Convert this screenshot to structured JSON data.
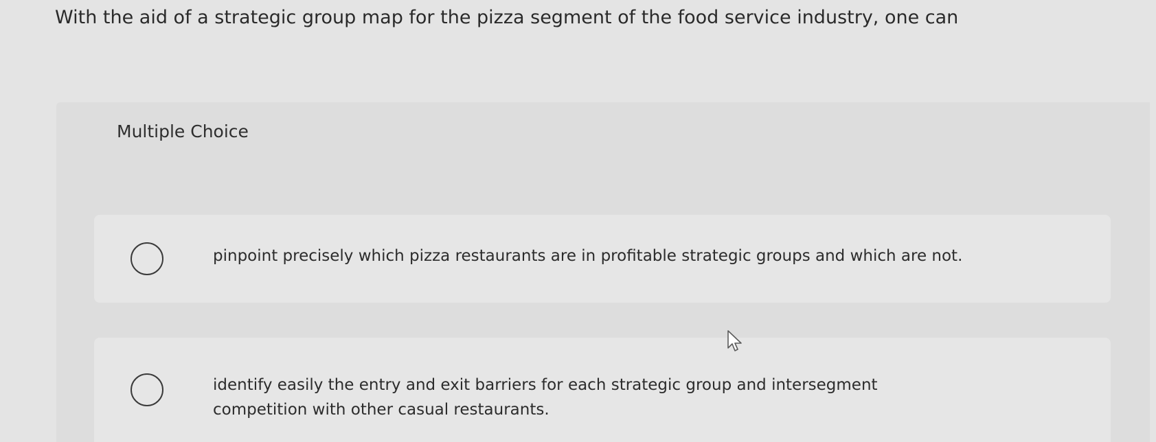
{
  "question": {
    "text": "With the aid of a strategic group map for the pizza segment of the food service industry, one can"
  },
  "choices_panel": {
    "label": "Multiple Choice",
    "options": [
      {
        "text": "pinpoint precisely which pizza restaurants are in profitable strategic groups and which are not."
      },
      {
        "text": "identify easily the entry and exit barriers for each strategic group and intersegment competition with other casual restaurants."
      }
    ]
  },
  "icons": {
    "radio": "radio-circle-icon",
    "cursor": "mouse-pointer-icon"
  },
  "colors": {
    "background": "#e4e4e4",
    "panel": "#dddddd",
    "option_background": "#e6e6e6",
    "text": "#2b2b2b"
  }
}
